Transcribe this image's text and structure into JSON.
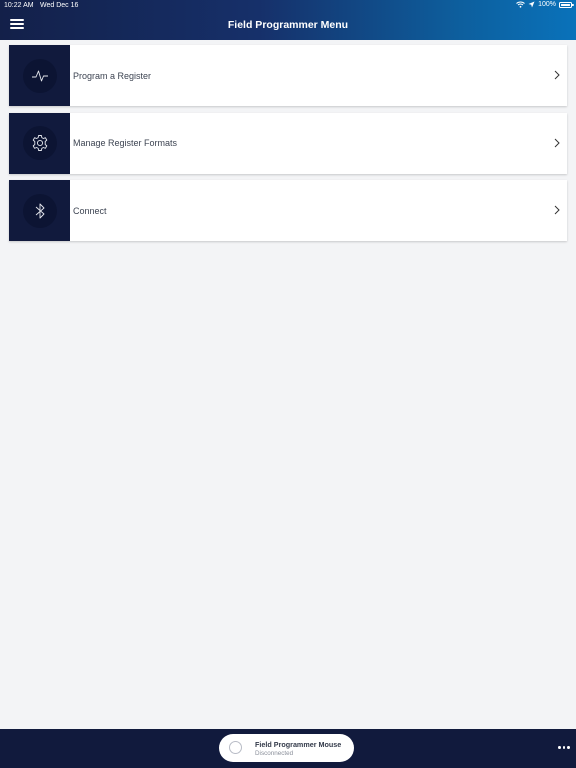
{
  "status_bar": {
    "time": "10:22 AM",
    "date": "Wed Dec 16",
    "battery": "100%",
    "icons": [
      "wifi-icon",
      "location-arrow-icon",
      "battery-icon"
    ]
  },
  "header": {
    "title": "Field Programmer Menu",
    "menu_icon": "hamburger-menu-icon"
  },
  "menu": {
    "items": [
      {
        "label": "Program a Register",
        "icon": "pulse-waveform-icon"
      },
      {
        "label": "Manage Register Formats",
        "icon": "gear-icon"
      },
      {
        "label": "Connect",
        "icon": "bluetooth-icon"
      }
    ]
  },
  "bottom_bar": {
    "device_name": "Field Programmer Mouse",
    "device_status": "Disconnected",
    "more_icon": "more-dots-icon"
  },
  "colors": {
    "header_gradient_start": "#132049",
    "header_gradient_end": "#0a72ba",
    "navy": "#111a3d",
    "background": "#f3f4f6"
  }
}
